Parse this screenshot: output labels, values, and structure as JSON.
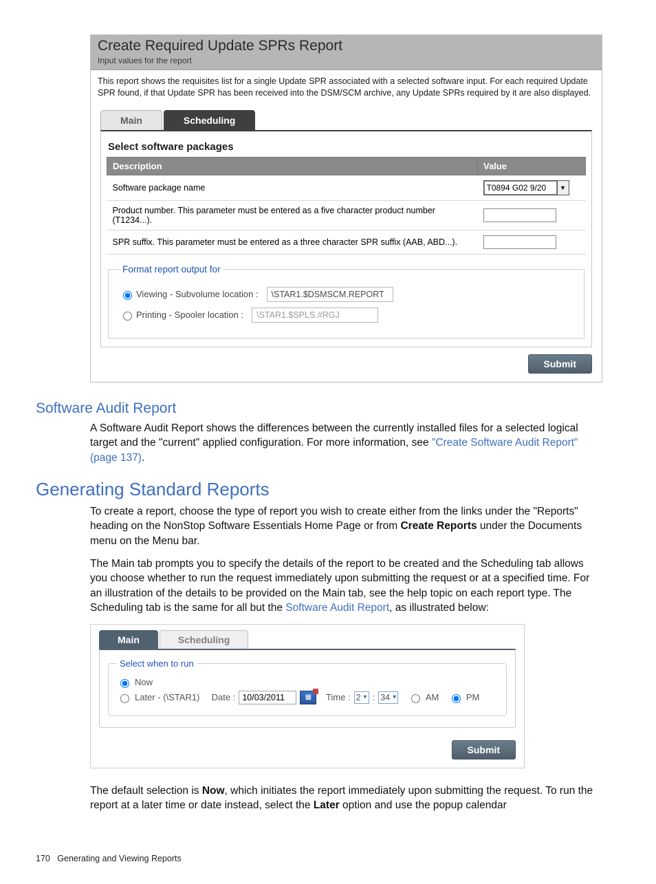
{
  "panel1": {
    "title": "Create Required Update SPRs Report",
    "subtitle": "Input values for the report",
    "intro": "This report shows the requisites list for a single Update SPR associated with a selected software input. For each required Update SPR found, if that Update SPR has been received into the DSM/SCM archive, any Update SPRs required by it are also displayed.",
    "tabs": {
      "main": "Main",
      "scheduling": "Scheduling"
    },
    "section_title": "Select software packages",
    "table": {
      "col_desc": "Description",
      "col_value": "Value",
      "rows": [
        {
          "desc": "Software package name",
          "value": "T0894 G02 9/20"
        },
        {
          "desc": "Product number. This parameter must be entered as a five character product number (T1234...).",
          "value": ""
        },
        {
          "desc": "SPR suffix. This parameter must be entered as a three character SPR suffix (AAB, ABD...).",
          "value": ""
        }
      ]
    },
    "output": {
      "legend": "Format report output for",
      "viewing_label": "Viewing - Subvolume location :",
      "viewing_path": "\\STAR1.$DSMSCM.REPORT",
      "printing_label": "Printing - Spooler location :",
      "printing_path": "\\STAR1.$SPLS.#RGJ"
    },
    "submit": "Submit"
  },
  "sar": {
    "heading": "Software Audit Report",
    "para_a": "A Software Audit Report shows the differences between the currently installed files for a selected logical target and the \"current\" applied configuration. For more information, see ",
    "link": "\"Create Software Audit Report\" (page 137)",
    "para_b": "."
  },
  "gsr": {
    "heading": "Generating Standard Reports",
    "p1_a": "To create a report, choose the type of report you wish to create either from the links under the \"Reports\" heading on the NonStop Software Essentials Home Page or from ",
    "p1_bold": "Create Reports",
    "p1_b": " under the Documents menu on the Menu bar.",
    "p2_a": "The Main tab prompts you to specify the details of the report to be created and the Scheduling tab allows you choose whether to run the request immediately upon submitting the request or at a specified time. For an illustration of the details to be provided on the Main tab, see the help topic on each report type. The Scheduling tab is the same for all but the ",
    "p2_link": "Software Audit Report",
    "p2_b": ", as illustrated below:"
  },
  "panel2": {
    "tabs": {
      "main": "Main",
      "scheduling": "Scheduling"
    },
    "legend": "Select when to run",
    "now": "Now",
    "later": "Later - (\\STAR1)",
    "date_label": "Date :",
    "date_value": "10/03/2011",
    "time_label": "Time :",
    "hour": "2",
    "minute": "34",
    "colon": ":",
    "am": "AM",
    "pm": "PM",
    "submit": "Submit"
  },
  "after": {
    "p_a": "The default selection is ",
    "bold1": "Now",
    "p_b": ", which initiates the report immediately upon submitting the request. To run the report at a later time or date instead, select the ",
    "bold2": "Later",
    "p_c": " option and use the popup calendar"
  },
  "footer": {
    "pagenum": "170",
    "section": "Generating and Viewing Reports"
  }
}
